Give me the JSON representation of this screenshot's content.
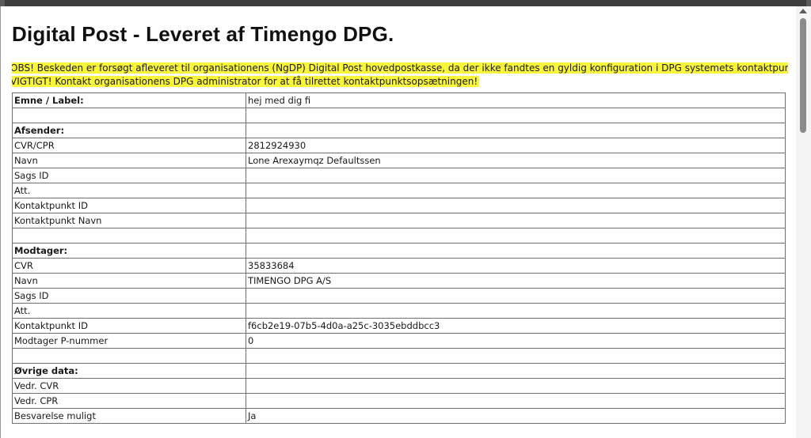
{
  "document": {
    "title": "Digital Post - Leveret af Timengo DPG.",
    "notice_line1": "OBS! Beskeden er forsøgt afleveret til organisationens (NgDP) Digital Post hovedpostkasse, da der ikke fandtes en gyldig konfiguration i DPG systemets kontaktpunktopsætning.",
    "notice_line2": "VIGTIGT! Kontakt organisationens DPG administrator for at få tilrettet kontaktpunktsopsætningen!",
    "highlight_color": "#f9f53a"
  },
  "table": {
    "rows": [
      {
        "label": "Emne / Label:",
        "value": "hej med dig fi",
        "header": true
      },
      {
        "label": "",
        "value": "",
        "header": false
      },
      {
        "label": "Afsender:",
        "value": "",
        "header": true
      },
      {
        "label": "CVR/CPR",
        "value": "2812924930",
        "header": false
      },
      {
        "label": "Navn",
        "value": "Lone Arexaymqz Defaultssen",
        "header": false
      },
      {
        "label": "Sags ID",
        "value": "",
        "header": false
      },
      {
        "label": "Att.",
        "value": "",
        "header": false
      },
      {
        "label": "Kontaktpunkt ID",
        "value": "",
        "header": false
      },
      {
        "label": "Kontaktpunkt Navn",
        "value": "",
        "header": false
      },
      {
        "label": "",
        "value": "",
        "header": false
      },
      {
        "label": "Modtager:",
        "value": "",
        "header": true
      },
      {
        "label": "CVR",
        "value": "35833684",
        "header": false
      },
      {
        "label": "Navn",
        "value": "TIMENGO DPG A/S",
        "header": false
      },
      {
        "label": "Sags ID",
        "value": "",
        "header": false
      },
      {
        "label": "Att.",
        "value": "",
        "header": false
      },
      {
        "label": "Kontaktpunkt ID",
        "value": "f6cb2e19-07b5-4d0a-a25c-3035ebddbcc3",
        "header": false
      },
      {
        "label": "Modtager P-nummer",
        "value": "0",
        "header": false
      },
      {
        "label": "",
        "value": "",
        "header": false
      },
      {
        "label": "Øvrige data:",
        "value": "",
        "header": true
      },
      {
        "label": "Vedr. CVR",
        "value": "",
        "header": false
      },
      {
        "label": "Vedr. CPR",
        "value": "",
        "header": false
      },
      {
        "label": "Besvarelse muligt",
        "value": "Ja",
        "header": false
      }
    ]
  }
}
